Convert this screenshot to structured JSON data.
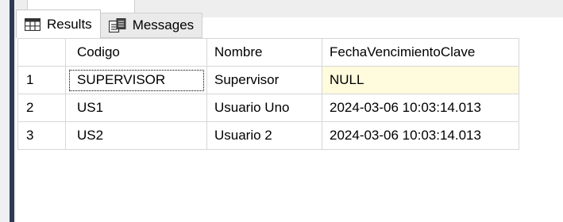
{
  "tabs": {
    "results_label": "Results",
    "messages_label": "Messages"
  },
  "grid": {
    "columns": [
      "Codigo",
      "Nombre",
      "FechaVencimientoClave"
    ],
    "rows": [
      {
        "num": "1",
        "codigo": "SUPERVISOR",
        "nombre": "Supervisor",
        "fecha": "NULL"
      },
      {
        "num": "2",
        "codigo": "US1",
        "nombre": "Usuario Uno",
        "fecha": "2024-03-06 10:03:14.013"
      },
      {
        "num": "3",
        "codigo": "US2",
        "nombre": "Usuario 2",
        "fecha": "2024-03-06 10:03:14.013"
      }
    ]
  },
  "colors": {
    "null_highlight": "#fffbdd",
    "grid_border": "#d7d7d7",
    "left_bar": "#2f3b52"
  }
}
